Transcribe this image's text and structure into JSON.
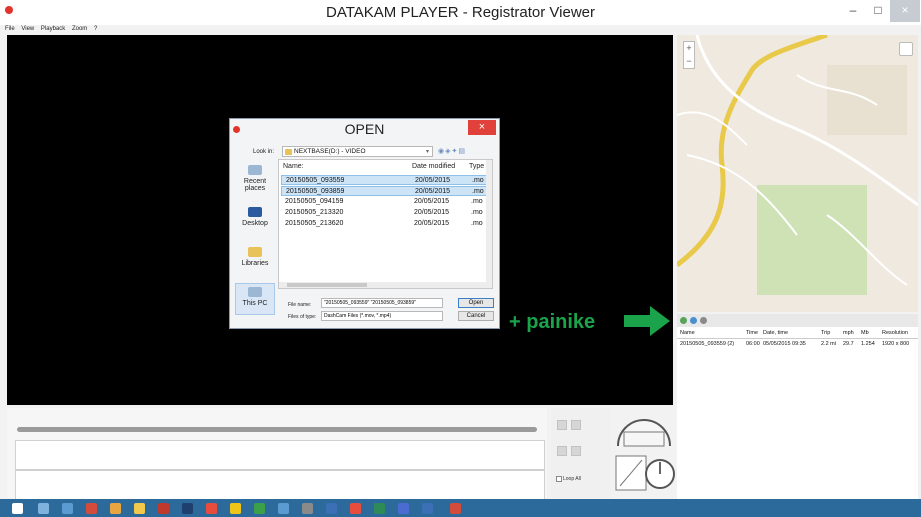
{
  "window": {
    "title": "DATAKAM PLAYER - Registrator Viewer",
    "min": "–",
    "max": "□",
    "close": "×"
  },
  "menu": [
    "File",
    "View",
    "Playback",
    "Zoom",
    "?"
  ],
  "map": {
    "zoom_in": "+",
    "zoom_out": "−",
    "route_color": "#e8c94a",
    "park_color": "#cfe2b5"
  },
  "file_list": {
    "columns": [
      "Name",
      "Time",
      "Date, time",
      "Trip",
      "mph",
      "Mb",
      "Resolution"
    ],
    "rows": [
      {
        "name": "20150505_093559 (2)",
        "time": "06:00",
        "date_time": "05/05/2015 09:35",
        "trip": "2.2 mi",
        "mph": "29.7",
        "mb": "1.254",
        "resolution": "1920 x 800"
      }
    ]
  },
  "controls": {
    "loop_label": "Loop All"
  },
  "dialog": {
    "title": "OPEN",
    "close": "×",
    "look_in_label": "Look in:",
    "look_in_value": "NEXTBASE(D:) - VIDEO",
    "places": [
      "Recent places",
      "Desktop",
      "Libraries",
      "This PC"
    ],
    "columns": {
      "name": "Name:",
      "date": "Date modified",
      "type": "Type"
    },
    "files": [
      {
        "name": "20150505_093559",
        "date": "20/05/2015",
        "type": ".mo",
        "selected": true
      },
      {
        "name": "20150505_093859",
        "date": "20/05/2015",
        "type": ".mo",
        "selected": true
      },
      {
        "name": "20150505_094159",
        "date": "20/05/2015",
        "type": ".mo",
        "selected": false
      },
      {
        "name": "20150505_213320",
        "date": "20/05/2015",
        "type": ".mo",
        "selected": false
      },
      {
        "name": "20150505_213620",
        "date": "20/05/2015",
        "type": ".mo",
        "selected": false
      }
    ],
    "file_name_label": "File name:",
    "file_name_value": "\"20150505_093559\" \"20150505_093859\"",
    "file_type_label": "Files of type:",
    "file_type_value": "DashCam Files (*.mov, *.mp4)",
    "open_button": "Open",
    "cancel_button": "Cancel"
  },
  "annotation": {
    "label": "+ painike",
    "color": "#1aa34a"
  },
  "colors": {
    "taskbar": "#2d6a9c",
    "close_red": "#e0413a",
    "selection": "#cde4f7"
  }
}
